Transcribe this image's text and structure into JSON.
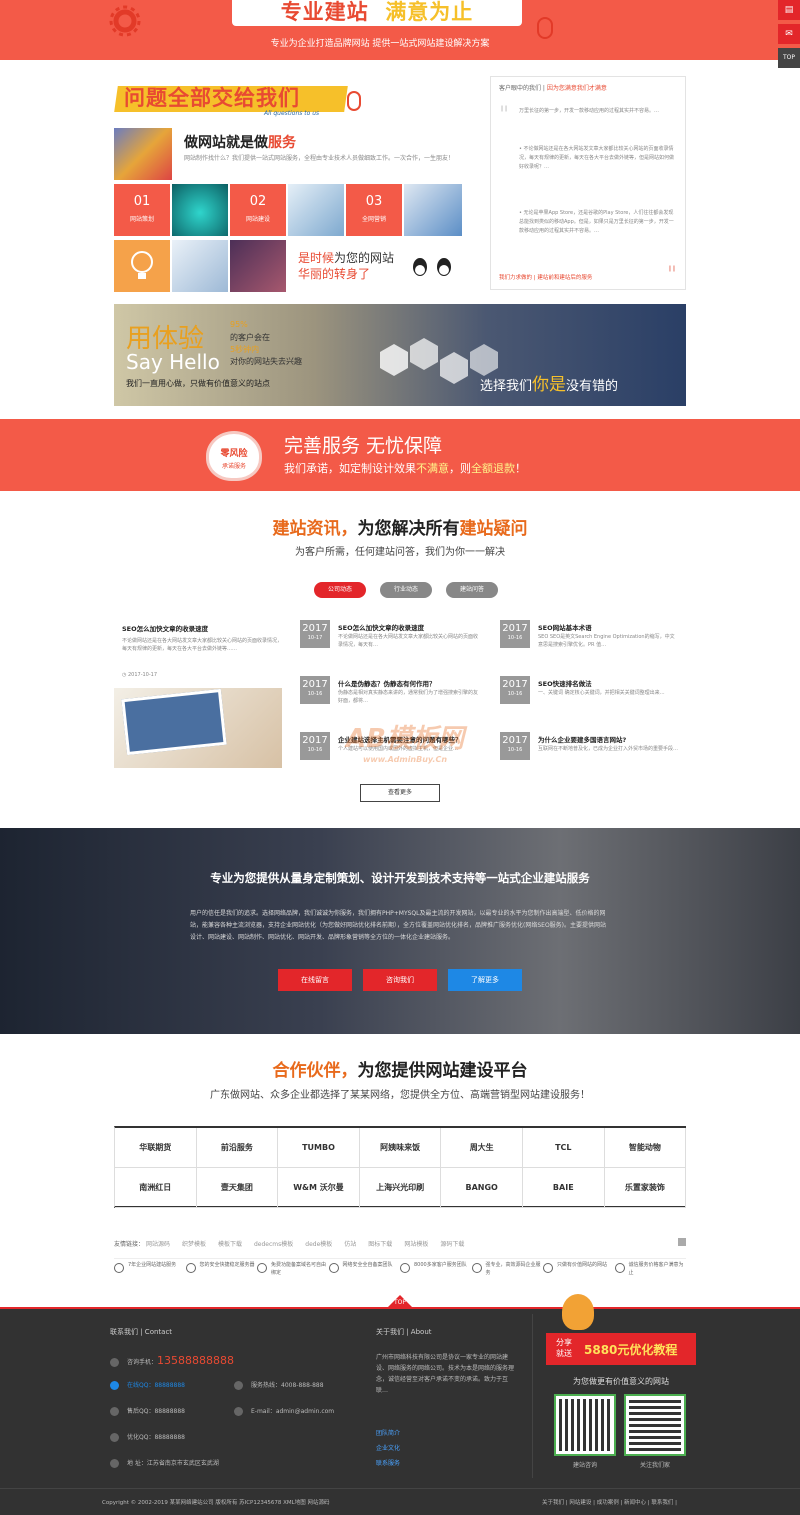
{
  "top_banner": {
    "title_a": "专业建站",
    "title_b": "满意为止",
    "subtitle": "专业为企业打造品牌网站 提供一站式网站建设解决方案"
  },
  "sidebar": {
    "top_label": "TOP"
  },
  "problem": {
    "heading": "问题全部交给我们",
    "heading_en": "All questions to us",
    "do_title_a": "做网站就是做",
    "do_title_b": "服务",
    "do_desc": "网站制作找什么？我们提供一站式网站服务，全程由专业技术人员做细致工作。一次合作，一生朋友！",
    "tiles": [
      {
        "num": "01",
        "label": "网站策划"
      },
      {
        "num": "02",
        "label": "网站建设"
      },
      {
        "num": "03",
        "label": "全网营销"
      }
    ],
    "slogan_a_pre": "是时候",
    "slogan_a_red": "为您的网站",
    "slogan_b": "华丽的转身了"
  },
  "faq": {
    "header_a": "客户眼中的我们",
    "header_b": "因为您满意我们才满意",
    "items": [
      "万里长征的第一步，开发一款移动应用的过程其实并不容易。…",
      "• 不论做网站还是在各大网站发文章大家都比较关心网站的页面收录情况，每天有规律的更新，每天在各大平台去做外链等，但是网站如何做好收录呢？…",
      "• 无论是苹果App Store，还是谷歌的Play Store，人们往往都会发现总能找到类似的移动App。但是，如果只是万里长征的第一步，开发一款移动应用的过程其实并不容易。…"
    ],
    "footer_a": "我们力求做的",
    "footer_b": "建站前和建站后的服务"
  },
  "hello": {
    "big": "用体验",
    "en": "Say Hello",
    "pct": "95%",
    "l1": "的客户会在",
    "l2": "5秒钟内",
    "l3": "对你的网站失去兴趣",
    "l4": "我们一直用心做，只做有价值意义的站点",
    "right_a": "选择我们",
    "right_b": "你是",
    "right_c": "没有错的"
  },
  "promise": {
    "badge_a": "零风险",
    "badge_b": "承诺服务",
    "title": "完善服务  无忧保障",
    "line_a": "我们承诺，如定制设计效果",
    "line_b": "不满意",
    "line_c": "，则",
    "line_d": "全额退款",
    "line_e": "！"
  },
  "news": {
    "title_a": "建站资讯，",
    "title_b": "为您解决所有",
    "title_c": "建站疑问",
    "subtitle": "为客户所需，任何建站问答，我们为你一一解决",
    "tabs": [
      "公司动态",
      "行业动态",
      "建站问答"
    ],
    "feature_title": "SEO怎么加快文章的收录速度",
    "feature_desc": "不论做网站还是在各大网站发文章大家都比较关心网站的页面收录情况，每天有规律的更新，每天在各大平台去做外链等……",
    "feature_date": "2017-10-17",
    "col2": [
      {
        "y": "2017",
        "d": "10-17",
        "t": "SEO怎么加快文章的收录速度",
        "s": "不论做网站还是在各大网站发文章大家都比较关心网站的页面收录情况，每天有…"
      },
      {
        "y": "2017",
        "d": "10-16",
        "t": "什么是伪静态？伪静态有何作用？",
        "s": "伪静态是相对真实静态来讲的，通常我们为了增强搜索引擎的友好面，都将…"
      },
      {
        "y": "2017",
        "d": "10-16",
        "t": "企业建站选择主机需要注意的问题有哪些？",
        "s": "个人建站可以使用国内或国外的虚拟主机，但是企业…"
      }
    ],
    "col3": [
      {
        "y": "2017",
        "d": "10-16",
        "t": "SEO网站基本术语",
        "s": "SEO SEO是英文Search Engine Optimization的缩写，中文意思是搜索引擎优化。PR 值…"
      },
      {
        "y": "2017",
        "d": "10-16",
        "t": "SEO快速排名做法",
        "s": "一、关键词 确定核心关键词，并把相关关键词整理出来…"
      },
      {
        "y": "2017",
        "d": "10-16",
        "t": "为什么企业要建多国语言网站?",
        "s": "互联网在不断地普及化，已成为企业打入外贸市场的重要手段…"
      }
    ],
    "more": "查看更多",
    "watermark": "AB模板网",
    "watermark_url": "www.AdminBuy.Cn"
  },
  "dark": {
    "title": "专业为您提供从量身定制策划、设计开发到技术支持等一站式企业建站服务",
    "desc": "用户的信任是我们的追求。选择网络品牌，我们诚诚为你服务，我们拥有PHP+MYSQL及最主流的开发网站，以最专业的水平为您制作出高端型、低价格的网站，能兼容各种主流浏览器，支持企业网站优化（为您做好网站优化排名前期），全方位覆盖网站优化排名，品牌推广服务优化(网络SEO服务)。主要提供网站设计、网站建设、网站制作、网站优化、网站开发、品牌形象营销等全方位的一体化企业建站服务。",
    "btn1": "在线留言",
    "btn2": "咨询我们",
    "btn3": "了解更多"
  },
  "partners": {
    "title_a": "合作伙伴，",
    "title_b": "为您提供网站建设平台",
    "subtitle": "广东做网站、众多企业都选择了某某网络，您提供全方位、高端营销型网站建设服务！",
    "logos": [
      "华联期货",
      "前沿服务",
      "TUMBO",
      "阿姨味来饭",
      "周大生",
      "TCL",
      "智能动物",
      "南洲红日",
      "壹天集团",
      "W&M 沃尔曼",
      "上海兴光印刷",
      "BANGO",
      "BAIE",
      "乐置家装饰"
    ]
  },
  "links": {
    "label": "友情链接：",
    "items": [
      "网站源码",
      "织梦模板",
      "模板下载",
      "dedecms模板",
      "dede模板",
      "仿站",
      "图标下载",
      "网站模板",
      "源码下载"
    ]
  },
  "features": [
    "7年企业网站建站服务",
    "您的安全快捷稳定服务器",
    "免费功能备案域名可自由绑定",
    "网络安全全自备案团队",
    "8000多家客户服务团队",
    "强专业，高效源码企业服务",
    "只做有价值网站的网站",
    "诚信服务价格客户满意为止"
  ],
  "footer": {
    "contact_title": "联系我们 | Contact",
    "phone_label": "咨询手机：",
    "phone": "13588888888",
    "qq1_label": "在线QQ：",
    "qq1": "88888888",
    "hotline_label": "服务热线：",
    "hotline": "4008-888-888",
    "qq2_label": "售后QQ：",
    "qq2": "88888888",
    "email_label": "E-mail：",
    "email": "admin@admin.com",
    "qq3_label": "优化QQ：",
    "qq3": "88888888",
    "addr_label": "地    址：",
    "addr": "江苏省南京市玄武区玄武湖",
    "about_title": "关于我们 | About",
    "about_desc": "广州市网络科技有限公司是协议一家专业的网站建设、网络服务的网络公司。技术为本是网络的服务理念，诚信经营至对客户承诺不变的承诺。致力于互联…",
    "about_links": [
      "团队简介",
      "企业文化",
      "联系服务"
    ],
    "share_a": "分享",
    "share_b": "就送",
    "share_price": "5880元优化教程",
    "value_line": "为您做更有价值意义的网站",
    "qr1": "建站咨询",
    "qr2": "关注我们家",
    "top_tab": "TOP",
    "copyright": "Copyright © 2002-2019 某某网络建站公司 版权所有   苏ICP12345678   XML地图   网站源码",
    "bottom_links": "关于我们 | 网站建设 | 成功案例 | 新闻中心 | 联系我们 |"
  }
}
